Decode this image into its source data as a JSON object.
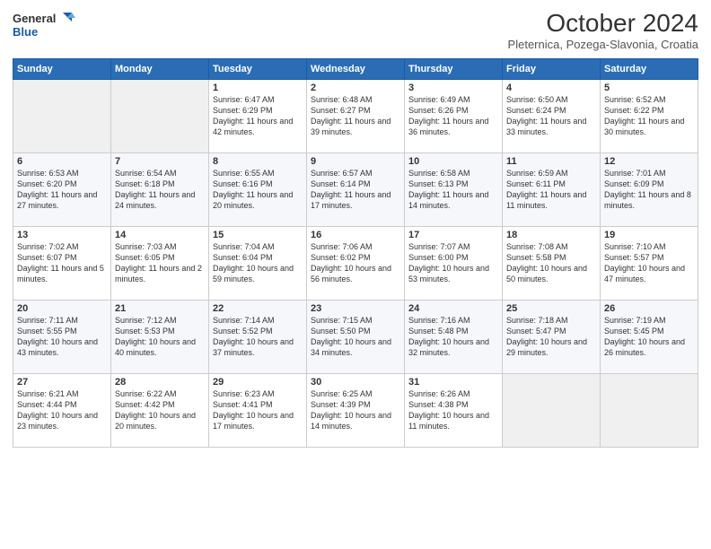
{
  "header": {
    "logo_line1": "General",
    "logo_line2": "Blue",
    "month": "October 2024",
    "location": "Pleternica, Pozega-Slavonia, Croatia"
  },
  "weekdays": [
    "Sunday",
    "Monday",
    "Tuesday",
    "Wednesday",
    "Thursday",
    "Friday",
    "Saturday"
  ],
  "weeks": [
    [
      {
        "day": "",
        "info": ""
      },
      {
        "day": "",
        "info": ""
      },
      {
        "day": "1",
        "info": "Sunrise: 6:47 AM\nSunset: 6:29 PM\nDaylight: 11 hours and 42 minutes."
      },
      {
        "day": "2",
        "info": "Sunrise: 6:48 AM\nSunset: 6:27 PM\nDaylight: 11 hours and 39 minutes."
      },
      {
        "day": "3",
        "info": "Sunrise: 6:49 AM\nSunset: 6:26 PM\nDaylight: 11 hours and 36 minutes."
      },
      {
        "day": "4",
        "info": "Sunrise: 6:50 AM\nSunset: 6:24 PM\nDaylight: 11 hours and 33 minutes."
      },
      {
        "day": "5",
        "info": "Sunrise: 6:52 AM\nSunset: 6:22 PM\nDaylight: 11 hours and 30 minutes."
      }
    ],
    [
      {
        "day": "6",
        "info": "Sunrise: 6:53 AM\nSunset: 6:20 PM\nDaylight: 11 hours and 27 minutes."
      },
      {
        "day": "7",
        "info": "Sunrise: 6:54 AM\nSunset: 6:18 PM\nDaylight: 11 hours and 24 minutes."
      },
      {
        "day": "8",
        "info": "Sunrise: 6:55 AM\nSunset: 6:16 PM\nDaylight: 11 hours and 20 minutes."
      },
      {
        "day": "9",
        "info": "Sunrise: 6:57 AM\nSunset: 6:14 PM\nDaylight: 11 hours and 17 minutes."
      },
      {
        "day": "10",
        "info": "Sunrise: 6:58 AM\nSunset: 6:13 PM\nDaylight: 11 hours and 14 minutes."
      },
      {
        "day": "11",
        "info": "Sunrise: 6:59 AM\nSunset: 6:11 PM\nDaylight: 11 hours and 11 minutes."
      },
      {
        "day": "12",
        "info": "Sunrise: 7:01 AM\nSunset: 6:09 PM\nDaylight: 11 hours and 8 minutes."
      }
    ],
    [
      {
        "day": "13",
        "info": "Sunrise: 7:02 AM\nSunset: 6:07 PM\nDaylight: 11 hours and 5 minutes."
      },
      {
        "day": "14",
        "info": "Sunrise: 7:03 AM\nSunset: 6:05 PM\nDaylight: 11 hours and 2 minutes."
      },
      {
        "day": "15",
        "info": "Sunrise: 7:04 AM\nSunset: 6:04 PM\nDaylight: 10 hours and 59 minutes."
      },
      {
        "day": "16",
        "info": "Sunrise: 7:06 AM\nSunset: 6:02 PM\nDaylight: 10 hours and 56 minutes."
      },
      {
        "day": "17",
        "info": "Sunrise: 7:07 AM\nSunset: 6:00 PM\nDaylight: 10 hours and 53 minutes."
      },
      {
        "day": "18",
        "info": "Sunrise: 7:08 AM\nSunset: 5:58 PM\nDaylight: 10 hours and 50 minutes."
      },
      {
        "day": "19",
        "info": "Sunrise: 7:10 AM\nSunset: 5:57 PM\nDaylight: 10 hours and 47 minutes."
      }
    ],
    [
      {
        "day": "20",
        "info": "Sunrise: 7:11 AM\nSunset: 5:55 PM\nDaylight: 10 hours and 43 minutes."
      },
      {
        "day": "21",
        "info": "Sunrise: 7:12 AM\nSunset: 5:53 PM\nDaylight: 10 hours and 40 minutes."
      },
      {
        "day": "22",
        "info": "Sunrise: 7:14 AM\nSunset: 5:52 PM\nDaylight: 10 hours and 37 minutes."
      },
      {
        "day": "23",
        "info": "Sunrise: 7:15 AM\nSunset: 5:50 PM\nDaylight: 10 hours and 34 minutes."
      },
      {
        "day": "24",
        "info": "Sunrise: 7:16 AM\nSunset: 5:48 PM\nDaylight: 10 hours and 32 minutes."
      },
      {
        "day": "25",
        "info": "Sunrise: 7:18 AM\nSunset: 5:47 PM\nDaylight: 10 hours and 29 minutes."
      },
      {
        "day": "26",
        "info": "Sunrise: 7:19 AM\nSunset: 5:45 PM\nDaylight: 10 hours and 26 minutes."
      }
    ],
    [
      {
        "day": "27",
        "info": "Sunrise: 6:21 AM\nSunset: 4:44 PM\nDaylight: 10 hours and 23 minutes."
      },
      {
        "day": "28",
        "info": "Sunrise: 6:22 AM\nSunset: 4:42 PM\nDaylight: 10 hours and 20 minutes."
      },
      {
        "day": "29",
        "info": "Sunrise: 6:23 AM\nSunset: 4:41 PM\nDaylight: 10 hours and 17 minutes."
      },
      {
        "day": "30",
        "info": "Sunrise: 6:25 AM\nSunset: 4:39 PM\nDaylight: 10 hours and 14 minutes."
      },
      {
        "day": "31",
        "info": "Sunrise: 6:26 AM\nSunset: 4:38 PM\nDaylight: 10 hours and 11 minutes."
      },
      {
        "day": "",
        "info": ""
      },
      {
        "day": "",
        "info": ""
      }
    ]
  ]
}
